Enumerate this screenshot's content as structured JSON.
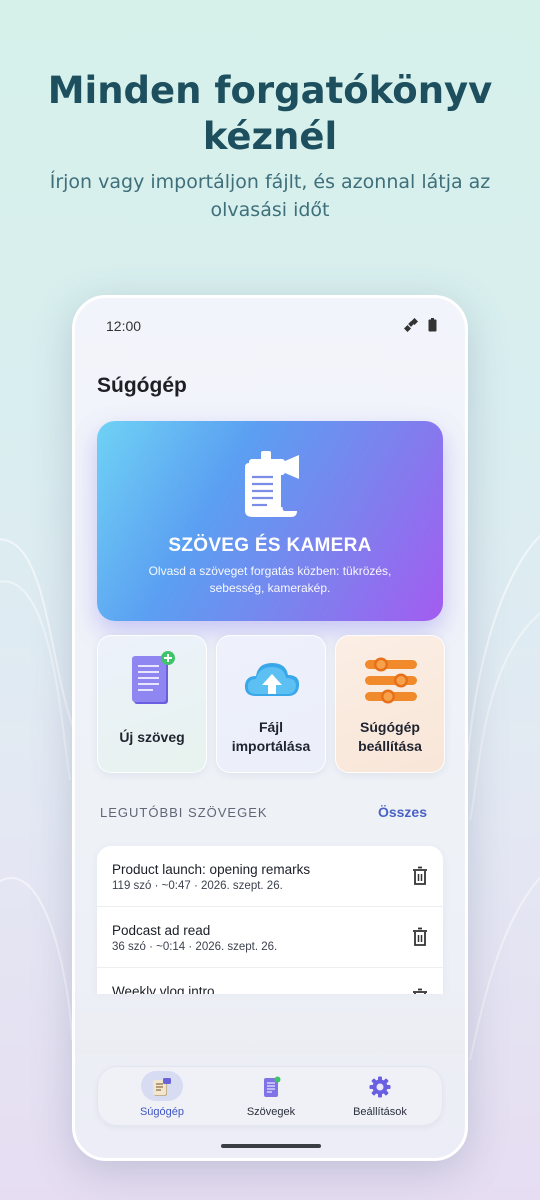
{
  "headline": "Minden forgatókönyv kéznél",
  "subheadline": "Írjon vagy importáljon fájlt, és azonnal látja az olvasási időt",
  "phone": {
    "status": {
      "time": "12:00"
    },
    "app_title": "Súgógép",
    "hero": {
      "title": "SZÖVEG ÉS KAMERA",
      "description": "Olvasd a szöveget forgatás közben: tükrözés, sebesség, kamerakép."
    },
    "tiles": [
      {
        "label": "Új szöveg",
        "icon": "new-document-icon"
      },
      {
        "label": "Fájl importálása",
        "icon": "cloud-upload-icon"
      },
      {
        "label": "Súgógép beállítása",
        "icon": "sliders-icon"
      }
    ],
    "recent": {
      "heading": "LEGUTÓBBI SZÖVEGEK",
      "all_label": "Összes",
      "items": [
        {
          "title": "Product launch: opening remarks",
          "meta": "119 szó · ~0:47 · 2026. szept. 26."
        },
        {
          "title": "Podcast ad read",
          "meta": "36 szó · ~0:14 · 2026. szept. 26."
        },
        {
          "title": "Weekly vlog intro",
          "meta": ""
        }
      ]
    },
    "nav": [
      {
        "label": "Súgógép",
        "icon": "teleprompter-icon",
        "active": true
      },
      {
        "label": "Szövegek",
        "icon": "documents-icon",
        "active": false
      },
      {
        "label": "Beállítások",
        "icon": "gear-icon",
        "active": false
      }
    ]
  },
  "colors": {
    "headline": "#1d4f5e",
    "accent": "#4a62c6",
    "hero_gradient_start": "#6fd2f4",
    "hero_gradient_end": "#a35cf0"
  }
}
